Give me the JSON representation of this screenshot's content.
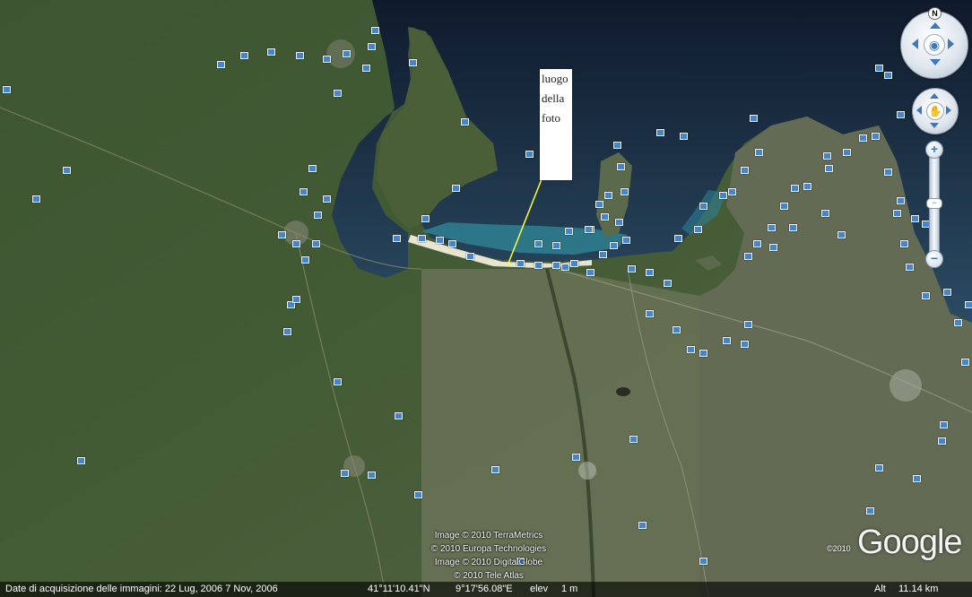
{
  "map": {
    "callout_lines": [
      "luogo",
      "della",
      "foto"
    ],
    "attribution": [
      "Image © 2010 TerraMetrics",
      "© 2010 Europa Technologies",
      "Image © 2010 DigitalGlobe",
      "© 2010 Tele Atlas"
    ],
    "copyright_year": "©2010",
    "logo_text": "Google"
  },
  "navigation": {
    "north_label": "N",
    "look_icon": "eye-icon",
    "move_icon": "hand-icon",
    "zoom_in_label": "+",
    "zoom_out_label": "−",
    "zoom_level": 0.45
  },
  "status_bar": {
    "acquisition_date": "Date di acquisizione delle immagini: 22 Lug, 2006 7 Nov, 2006",
    "latitude": "41°11'10.41\"N",
    "longitude": "9°17'56.08\"E",
    "elevation_label": "elev",
    "elevation_value": "1 m",
    "altitude_label": "Alt",
    "altitude_value": "11.14 km"
  },
  "colors": {
    "sea": "#23344c",
    "land": "#3c5230",
    "photo_pin": "#3f86d6",
    "callout_line": "#ffff33"
  }
}
